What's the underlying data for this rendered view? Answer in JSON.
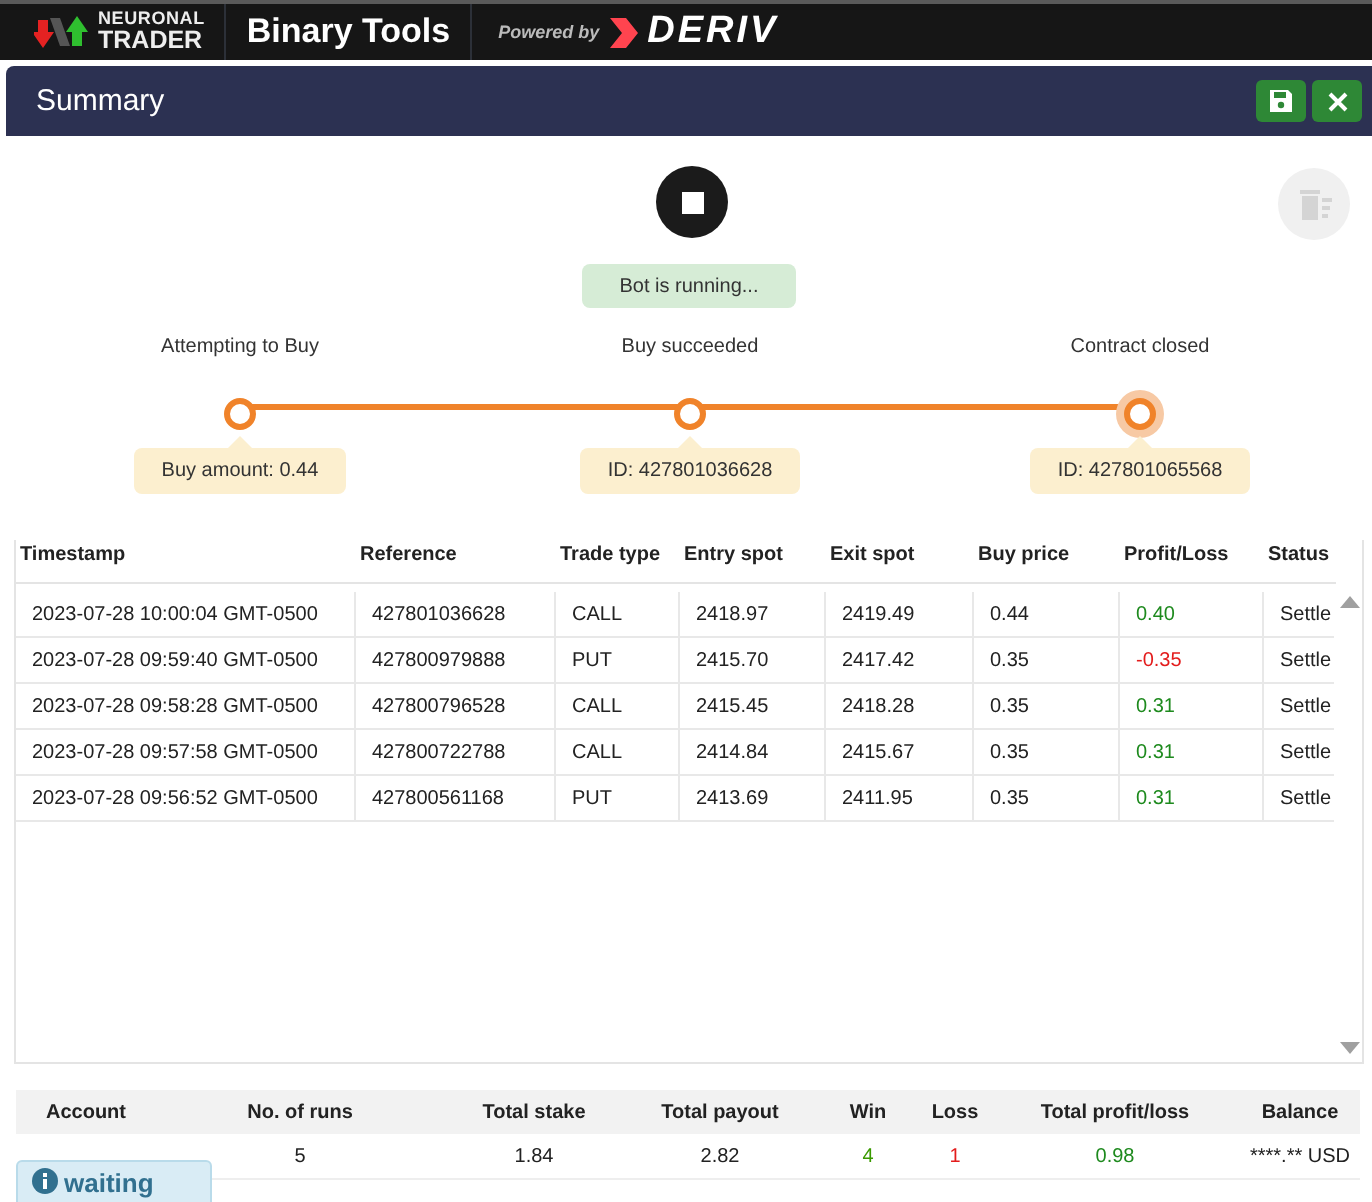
{
  "header": {
    "logo_top": "NEURONAL",
    "logo_bottom": "TRADER",
    "app_title": "Binary Tools",
    "powered_by": "Powered by",
    "brand": "DERIV"
  },
  "panel": {
    "title": "Summary"
  },
  "bot": {
    "status": "Bot is running...",
    "running": true
  },
  "steps": [
    {
      "label": "Attempting to Buy",
      "info": "Buy amount: 0.44",
      "active": false
    },
    {
      "label": "Buy succeeded",
      "info": "ID: 427801036628",
      "active": false
    },
    {
      "label": "Contract closed",
      "info": "ID: 427801065568",
      "active": true
    }
  ],
  "table": {
    "columns": [
      "Timestamp",
      "Reference",
      "Trade type",
      "Entry spot",
      "Exit spot",
      "Buy price",
      "Profit/Loss",
      "Status"
    ],
    "rows": [
      {
        "cells": [
          "2023-07-28 10:00:04 GMT-0500",
          "427801036628",
          "CALL",
          "2418.97",
          "2419.49",
          "0.44",
          "0.40",
          "Settle"
        ],
        "color": "#1e8a1e"
      },
      {
        "cells": [
          "2023-07-28 09:59:40 GMT-0500",
          "427800979888",
          "PUT",
          "2415.70",
          "2417.42",
          "0.35",
          "-0.35",
          "Settle"
        ],
        "color": "#e31c1c"
      },
      {
        "cells": [
          "2023-07-28 09:58:28 GMT-0500",
          "427800796528",
          "CALL",
          "2415.45",
          "2418.28",
          "0.35",
          "0.31",
          "Settle"
        ],
        "color": "#1e8a1e"
      },
      {
        "cells": [
          "2023-07-28 09:57:58 GMT-0500",
          "427800722788",
          "CALL",
          "2414.84",
          "2415.67",
          "0.35",
          "0.31",
          "Settle"
        ],
        "color": "#1e8a1e"
      },
      {
        "cells": [
          "2023-07-28 09:56:52 GMT-0500",
          "427800561168",
          "PUT",
          "2413.69",
          "2411.95",
          "0.35",
          "0.31",
          "Settle"
        ],
        "color": "#1e8a1e"
      }
    ]
  },
  "totals": [
    {
      "label": "Account"
    },
    {
      "label": "No. of runs",
      "value": "5"
    },
    {
      "label": "Total stake",
      "value": "1.84"
    },
    {
      "label": "Total payout",
      "value": "2.82"
    },
    {
      "label": "Win",
      "value": "4",
      "color": "#3a9a00"
    },
    {
      "label": "Loss",
      "value": "1",
      "color": "#e31c1c"
    },
    {
      "label": "Total profit/loss",
      "value": "0.98",
      "color": "#1e8a1e"
    },
    {
      "label": "Balance",
      "value": "****.** USD"
    }
  ],
  "notification": {
    "text": "waiting"
  }
}
